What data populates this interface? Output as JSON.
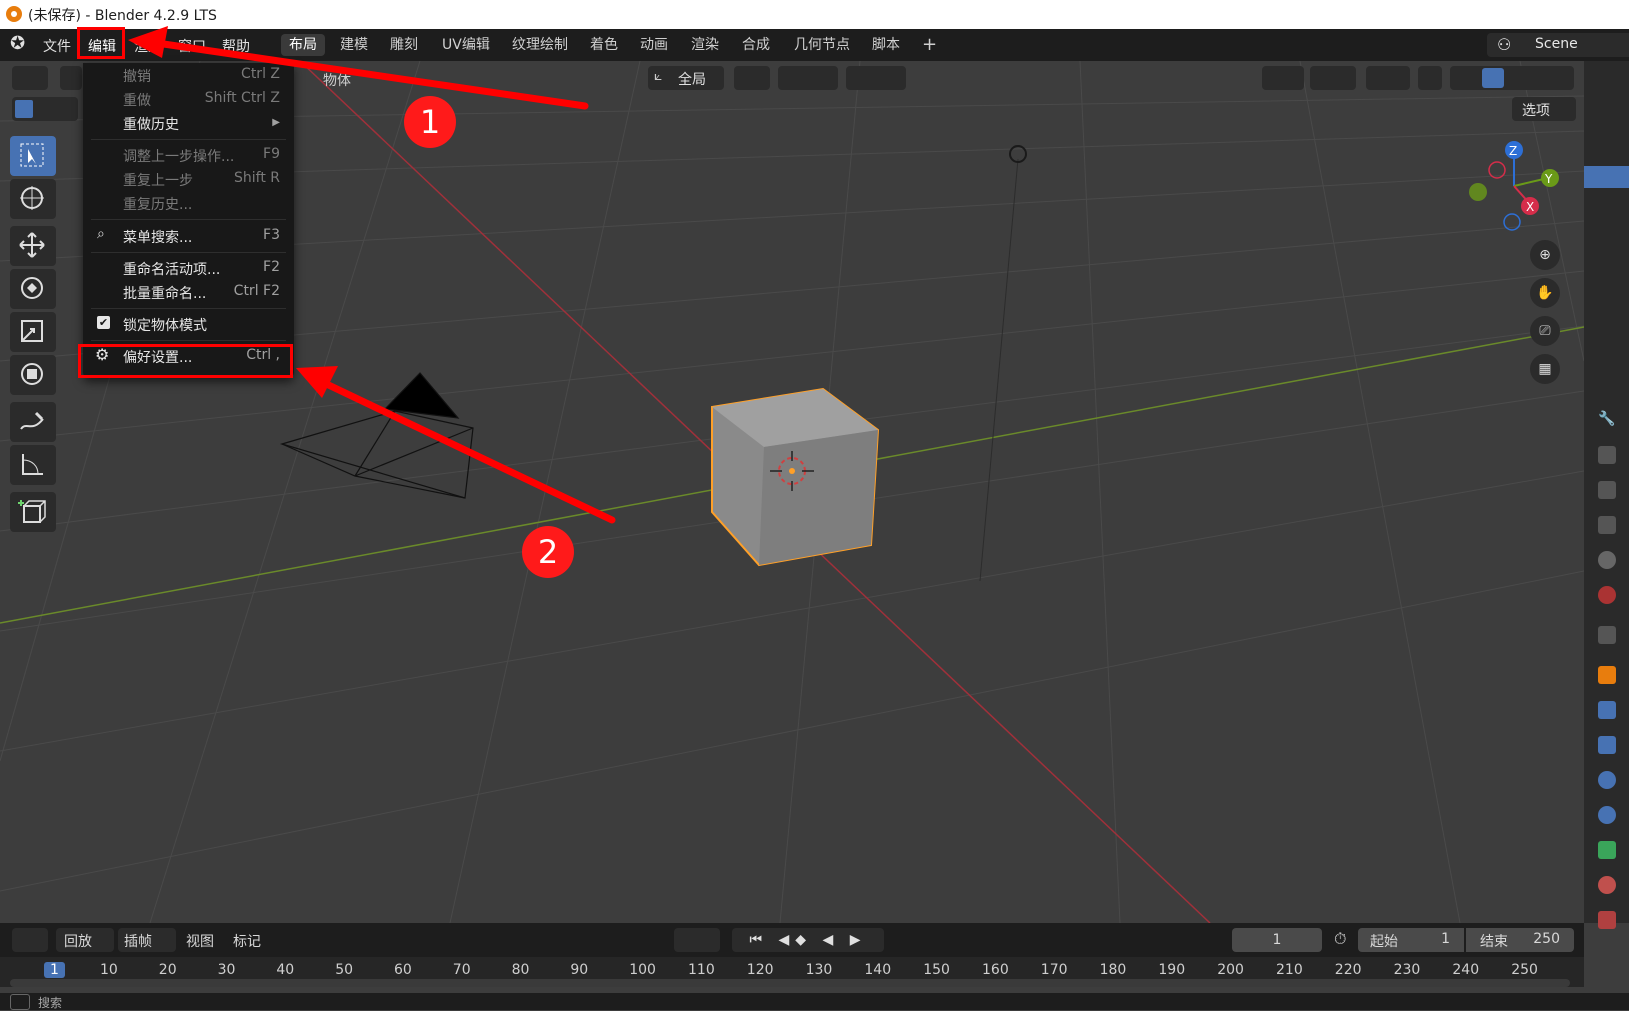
{
  "window": {
    "title": "(未保存) - Blender 4.2.9 LTS"
  },
  "menubar": {
    "items": [
      "文件",
      "编辑",
      "渲染",
      "窗口",
      "帮助"
    ]
  },
  "workspaces": {
    "tabs": [
      "布局",
      "建模",
      "雕刻",
      "UV编辑",
      "纹理绘制",
      "着色",
      "动画",
      "渲染",
      "合成",
      "几何节点",
      "脚本"
    ],
    "active": "布局",
    "add": "+"
  },
  "scene": {
    "name": "Scene"
  },
  "viewport_header": {
    "object_label": "物体",
    "transform_orientation": "全局",
    "options": "选项"
  },
  "edit_menu": {
    "undo": {
      "label": "撤销",
      "shortcut": "Ctrl Z"
    },
    "redo": {
      "label": "重做",
      "shortcut": "Shift Ctrl Z"
    },
    "undo_history": {
      "label": "重做历史"
    },
    "adjust_last": {
      "label": "调整上一步操作...",
      "shortcut": "F9"
    },
    "repeat_last": {
      "label": "重复上一步",
      "shortcut": "Shift R"
    },
    "repeat_history": {
      "label": "重复历史..."
    },
    "menu_search": {
      "label": "菜单搜索...",
      "shortcut": "F3"
    },
    "rename_active": {
      "label": "重命名活动项...",
      "shortcut": "F2"
    },
    "batch_rename": {
      "label": "批量重命名...",
      "shortcut": "Ctrl F2"
    },
    "lock_object_modes": {
      "label": "锁定物体模式",
      "checked": true
    },
    "preferences": {
      "label": "偏好设置...",
      "shortcut": "Ctrl ,"
    }
  },
  "annotations": {
    "badge1": "1",
    "badge2": "2",
    "color": "#ff0000"
  },
  "gizmo": {
    "z": "Z",
    "y": "Y",
    "x": "X"
  },
  "timeline": {
    "menus": [
      "回放",
      "插帧",
      "视图",
      "标记"
    ],
    "current_frame": "1",
    "start_label": "起始",
    "start": "1",
    "end_label": "结束",
    "end": "250",
    "ruler": [
      "1",
      "10",
      "20",
      "30",
      "40",
      "50",
      "60",
      "70",
      "80",
      "90",
      "100",
      "110",
      "120",
      "130",
      "140",
      "150",
      "160",
      "170",
      "180",
      "190",
      "200",
      "210",
      "220",
      "230",
      "240",
      "250"
    ]
  },
  "statusbar": {
    "search": "搜索"
  },
  "colors": {
    "selection": "#ffa028",
    "accent": "#4772b3",
    "x_axis": "#a0303a",
    "y_axis": "#6a8a2a"
  }
}
